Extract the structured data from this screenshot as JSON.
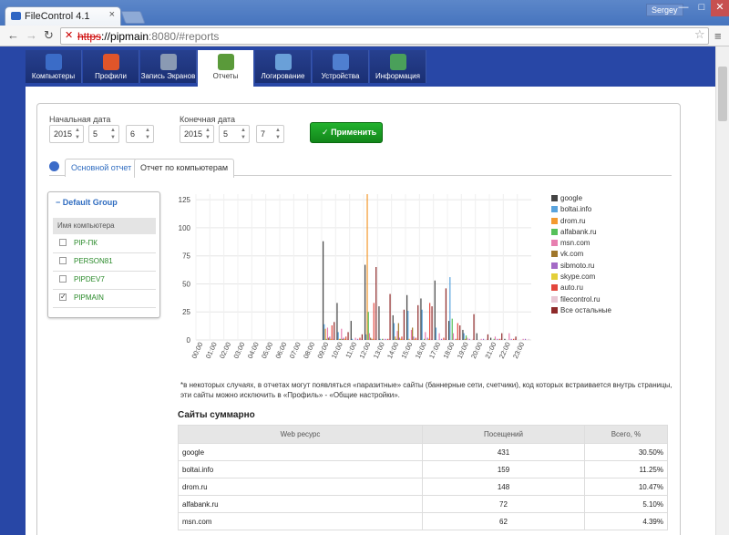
{
  "browser": {
    "tab_title": "FileControl 4.1",
    "tab_close": "×",
    "user": "Sergey",
    "url_scheme": "https",
    "url_host": "://pipmain",
    "url_rest": ":8080/#reports",
    "back": "←",
    "forward": "→",
    "reload": "↻",
    "star": "☆",
    "menu": "≡",
    "min": "—",
    "max": "□",
    "close": "✕"
  },
  "nav": [
    {
      "label": "Компьютеры",
      "icon": "monitor-icon",
      "color": "#3b6cc7"
    },
    {
      "label": "Профили",
      "icon": "shield-icon",
      "color": "#e0552a"
    },
    {
      "label": "Запись Экранов",
      "icon": "magnifier-icon",
      "color": "#8a9ab3"
    },
    {
      "label": "Отчеты",
      "icon": "chart-icon",
      "color": "#5a9a3a",
      "active": true
    },
    {
      "label": "Логирование",
      "icon": "log-icon",
      "color": "#6aa0d8"
    },
    {
      "label": "Устройства",
      "icon": "network-icon",
      "color": "#4f7fd0"
    },
    {
      "label": "Информация",
      "icon": "gear-icon",
      "color": "#4aa05a"
    }
  ],
  "filter": {
    "start_label": "Начальная дата",
    "start": [
      "2015",
      "5",
      "6"
    ],
    "end_label": "Конечная дата",
    "end": [
      "2015",
      "5",
      "7"
    ],
    "apply": "Применить",
    "check": "✓"
  },
  "subtabs": {
    "main": "Основной отчет",
    "pc": "Отчет по компьютерам"
  },
  "group": {
    "title": "Default Group",
    "collapse": "−",
    "col": "Имя компьютера",
    "check": "✓",
    "items": [
      {
        "name": "PIP-ПК",
        "checked": false
      },
      {
        "name": "PERSON81",
        "checked": false
      },
      {
        "name": "PIPDEV7",
        "checked": false
      },
      {
        "name": "PIPMAIN",
        "checked": true
      }
    ]
  },
  "chart_data": {
    "type": "bar",
    "categories": [
      "00:00",
      "01:00",
      "02:00",
      "03:00",
      "04:00",
      "05:00",
      "06:00",
      "07:00",
      "08:00",
      "09:00",
      "10:00",
      "11:00",
      "12:00",
      "13:00",
      "14:00",
      "15:00",
      "16:00",
      "17:00",
      "18:00",
      "19:00",
      "20:00",
      "21:00",
      "22:00",
      "23:00"
    ],
    "ylim": [
      0,
      130
    ],
    "yticks": [
      0,
      25,
      50,
      75,
      100,
      125
    ],
    "grid": true,
    "legend_position": "right",
    "series": [
      {
        "name": "google",
        "color": "#444444",
        "values": [
          0,
          0,
          0,
          0,
          0,
          0,
          0,
          0,
          0,
          88,
          33,
          17,
          67,
          30,
          22,
          40,
          37,
          53,
          17,
          9,
          6,
          2,
          1,
          0
        ]
      },
      {
        "name": "boltai.info",
        "color": "#5aa3dc",
        "values": [
          0,
          0,
          0,
          0,
          0,
          0,
          0,
          0,
          0,
          14,
          7,
          1,
          5,
          1,
          15,
          26,
          27,
          11,
          56,
          6,
          0,
          0,
          0,
          0
        ]
      },
      {
        "name": "drom.ru",
        "color": "#f39a2f",
        "values": [
          0,
          0,
          0,
          0,
          0,
          0,
          0,
          0,
          0,
          10,
          1,
          0,
          130,
          0,
          3,
          1,
          0,
          0,
          0,
          1,
          0,
          0,
          0,
          0
        ]
      },
      {
        "name": "alfabank.ru",
        "color": "#56c15a",
        "values": [
          0,
          0,
          0,
          0,
          0,
          0,
          0,
          0,
          0,
          1,
          1,
          0,
          25,
          1,
          1,
          0,
          1,
          0,
          19,
          4,
          0,
          1,
          0,
          0
        ]
      },
      {
        "name": "msn.com",
        "color": "#e77fb0",
        "values": [
          0,
          0,
          0,
          0,
          0,
          0,
          0,
          0,
          0,
          11,
          10,
          2,
          6,
          1,
          8,
          9,
          7,
          6,
          6,
          2,
          1,
          3,
          6,
          1
        ]
      },
      {
        "name": "vk.com",
        "color": "#a0772b",
        "values": [
          0,
          0,
          0,
          0,
          0,
          0,
          0,
          0,
          0,
          2,
          1,
          0,
          2,
          0,
          15,
          11,
          0,
          0,
          0,
          0,
          0,
          0,
          0,
          0
        ]
      },
      {
        "name": "sibmoto.ru",
        "color": "#a46ac6",
        "values": [
          0,
          0,
          0,
          0,
          0,
          0,
          0,
          0,
          0,
          3,
          2,
          1,
          1,
          1,
          2,
          3,
          2,
          1,
          1,
          1,
          1,
          1,
          1,
          1
        ]
      },
      {
        "name": "skype.com",
        "color": "#e3cf38",
        "values": [
          0,
          0,
          0,
          0,
          0,
          0,
          0,
          0,
          0,
          1,
          1,
          0,
          1,
          0,
          1,
          1,
          1,
          0,
          1,
          0,
          0,
          0,
          0,
          0
        ]
      },
      {
        "name": "auto.ru",
        "color": "#e3463c",
        "values": [
          0,
          0,
          0,
          0,
          0,
          0,
          0,
          0,
          0,
          13,
          3,
          2,
          33,
          1,
          3,
          2,
          33,
          2,
          15,
          0,
          0,
          1,
          1,
          0
        ]
      },
      {
        "name": "filecontrol.ru",
        "color": "#e9c7d4",
        "values": [
          0,
          0,
          0,
          0,
          0,
          0,
          0,
          0,
          0,
          1,
          1,
          1,
          1,
          1,
          1,
          1,
          1,
          1,
          1,
          1,
          1,
          1,
          1,
          1
        ]
      },
      {
        "name": "Все остальные",
        "color": "#8e2a2a",
        "values": [
          0,
          0,
          0,
          0,
          0,
          0,
          0,
          0,
          0,
          16,
          7,
          5,
          65,
          41,
          27,
          31,
          30,
          46,
          13,
          23,
          5,
          6,
          3,
          0
        ]
      }
    ]
  },
  "note": "*в некоторых случаях, в отчетах могут появляться «паразитные» сайты (баннерные сети, счетчики), код которых встраивается внутрь страницы, эти сайты можно исключить в «Профиль» - «Общие настройки».",
  "summary": {
    "title": "Сайты суммарно",
    "cols": [
      "Web ресурс",
      "Посещений",
      "Всего, %"
    ],
    "rows": [
      [
        "google",
        "431",
        "30.50%"
      ],
      [
        "boltai.info",
        "159",
        "11.25%"
      ],
      [
        "drom.ru",
        "148",
        "10.47%"
      ],
      [
        "alfabank.ru",
        "72",
        "5.10%"
      ],
      [
        "msn.com",
        "62",
        "4.39%"
      ]
    ]
  }
}
